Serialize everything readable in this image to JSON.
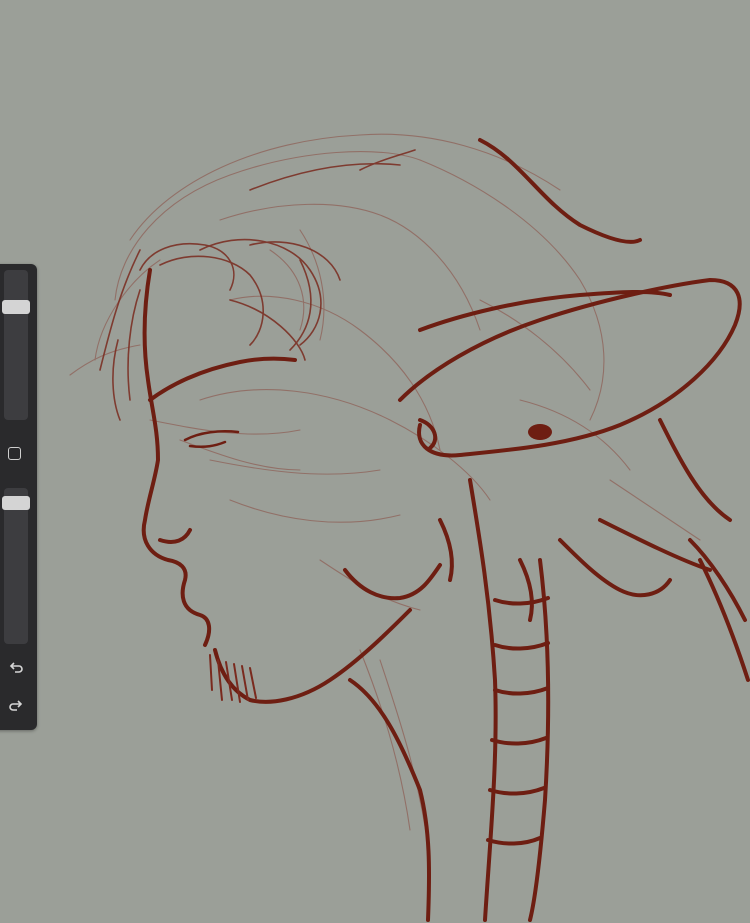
{
  "app": "drawing-canvas",
  "canvas": {
    "background_color": "#9b9f98",
    "stroke_color": "#6e1e12",
    "sketch_line_color": "#8a4a40",
    "subject": "sketch-elf-profile"
  },
  "sidebar": {
    "brush_size": {
      "level": 0.78
    },
    "brush_opacity": {
      "level": 0.05
    },
    "modify_icon": "square-outline-icon",
    "undo_icon": "undo-arrow-icon",
    "redo_icon": "redo-arrow-icon"
  }
}
